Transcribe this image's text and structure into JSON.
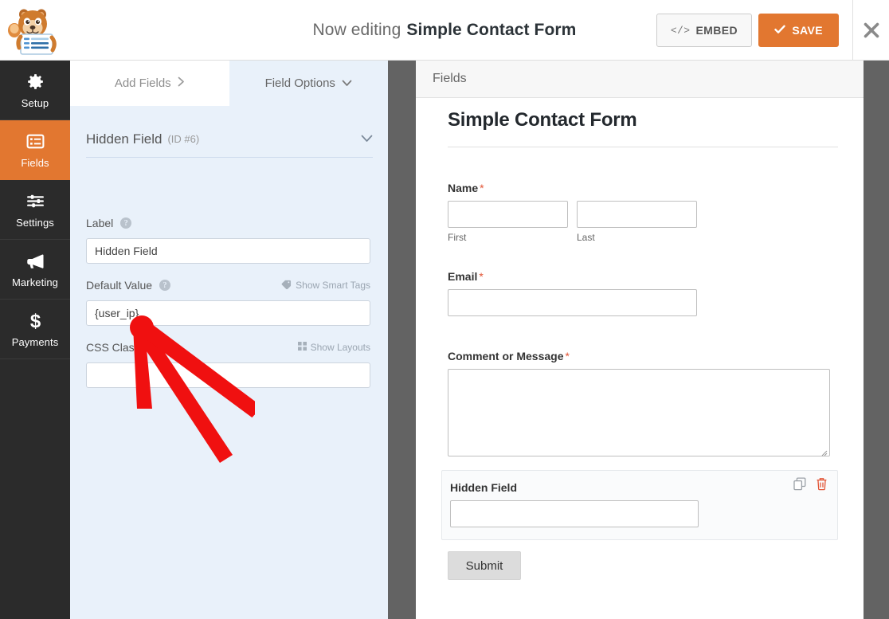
{
  "topbar": {
    "editing_prefix": "Now editing",
    "form_name": "Simple Contact Form",
    "embed_label": "EMBED",
    "embed_icon": "code-icon",
    "save_label": "SAVE",
    "save_icon": "check-icon",
    "close_icon": "close-icon",
    "logo_icon": "wpforms-mascot-logo",
    "accent_color": "#e27730"
  },
  "sidebar": {
    "items": [
      {
        "label": "Setup",
        "icon": "gear-icon",
        "active": false
      },
      {
        "label": "Fields",
        "icon": "list-icon",
        "active": true
      },
      {
        "label": "Settings",
        "icon": "sliders-icon",
        "active": false
      },
      {
        "label": "Marketing",
        "icon": "megaphone-icon",
        "active": false
      },
      {
        "label": "Payments",
        "icon": "dollar-icon",
        "active": false
      }
    ]
  },
  "panel": {
    "tabs": [
      {
        "label": "Add Fields",
        "icon": "chevron-right-icon",
        "active": false
      },
      {
        "label": "Field Options",
        "icon": "chevron-down-icon",
        "active": true
      }
    ],
    "field_header": {
      "title": "Hidden Field",
      "id": "(ID #6)",
      "caret_icon": "chevron-down-icon"
    },
    "options": {
      "label": {
        "label": "Label",
        "help_icon": "question-icon",
        "value": "Hidden Field"
      },
      "default_value": {
        "label": "Default Value",
        "help_icon": "question-icon",
        "link_label": "Show Smart Tags",
        "link_icon": "tag-icon",
        "value": "{user_ip}"
      },
      "css_classes": {
        "label": "CSS Classes",
        "link_label": "Show Layouts",
        "link_icon": "grid-icon",
        "value": ""
      }
    }
  },
  "content": {
    "section_title": "Fields"
  },
  "preview": {
    "form_title": "Simple Contact Form",
    "fields": [
      {
        "label": "Name",
        "required": true,
        "required_marker": "*",
        "type": "name",
        "sublabels": [
          "First",
          "Last"
        ]
      },
      {
        "label": "Email",
        "required": true,
        "required_marker": "*",
        "type": "text"
      },
      {
        "label": "Comment or Message",
        "required": true,
        "required_marker": "*",
        "type": "textarea"
      }
    ],
    "hidden_field": {
      "label": "Hidden Field",
      "duplicate_icon": "duplicate-icon",
      "delete_icon": "trash-icon",
      "delete_color": "#e25536"
    },
    "submit_label": "Submit"
  },
  "annotation": {
    "type": "arrow",
    "color": "#f01010",
    "points_at": "default-value-input"
  }
}
